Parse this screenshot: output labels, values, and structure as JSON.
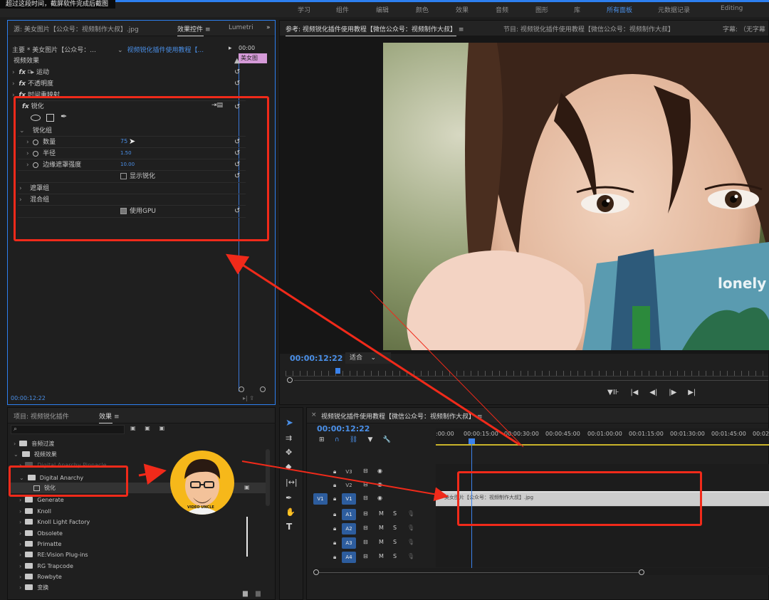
{
  "hint": "超过这段时间，截屏软件完成后截图",
  "workspaces": [
    "学习",
    "组件",
    "编辑",
    "颜色",
    "效果",
    "音频",
    "图形",
    "库",
    "所有面板",
    "元数据记录",
    "Editing"
  ],
  "source_panel": {
    "tab_source": "源: 美女图片【公众号：视频制作大叔】.jpg",
    "tab_effect_controls": "效果控件",
    "tab_lumetri": "Lumetri",
    "master_label": "主要 * 美女图片【公众号：...",
    "sequence_label": "视频锐化插件使用教程【...",
    "time_top": "00:00",
    "clip_label": "美女图",
    "video_effects_label": "视频效果",
    "motion": "运动",
    "opacity": "不透明度",
    "time_remap": "时间重映射",
    "sharpen": "锐化",
    "sharpen_group": "锐化组",
    "amount_label": "数量",
    "amount_value": "75",
    "radius_label": "半径",
    "radius_value": "1.50",
    "edge_label": "边缘遮罩强度",
    "edge_value": "10.00",
    "show_sharpen": "显示锐化",
    "mask_group": "遮罩组",
    "blend_group": "混合组",
    "use_gpu": "使用GPU",
    "timecode": "00:00:12:22"
  },
  "program_panel": {
    "tab_reference": "参考: 视频锐化插件使用教程【微信公众号：视频制作大叔】",
    "tab_program": "节目: 视频锐化插件使用教程【微信公众号：视频制作大叔】",
    "tab_caption": "字幕: （无字幕",
    "timecode": "00:00:12:22",
    "fit": "适合"
  },
  "project_panel": {
    "tab_project": "项目: 视频锐化插件",
    "tab_effects": "效果",
    "items": [
      {
        "label": "音频过渡",
        "indent": 0
      },
      {
        "label": "视频效果",
        "indent": 0
      },
      {
        "label": "Digital Anarchy Pinnacle...",
        "indent": 1
      },
      {
        "label": "Digital Anarchy",
        "indent": 1
      },
      {
        "label": "锐化",
        "indent": 2
      },
      {
        "label": "Generate",
        "indent": 1
      },
      {
        "label": "Knoll",
        "indent": 1
      },
      {
        "label": "Knoll Light Factory",
        "indent": 1
      },
      {
        "label": "Obsolete",
        "indent": 1
      },
      {
        "label": "Primatte",
        "indent": 1
      },
      {
        "label": "RE:Vision Plug-ins",
        "indent": 1
      },
      {
        "label": "RG Trapcode",
        "indent": 1
      },
      {
        "label": "Rowbyte",
        "indent": 1
      },
      {
        "label": "变换",
        "indent": 1
      }
    ],
    "badge_text": "VIDEO UNCLE"
  },
  "timeline": {
    "title": "视频锐化插件使用教程【微信公众号：视频制作大叔】",
    "timecode": "00:00:12:22",
    "ruler": [
      ":00:00",
      "00:00:15:00",
      "00:00:30:00",
      "00:00:45:00",
      "00:01:00:00",
      "00:01:15:00",
      "00:01:30:00",
      "00:01:45:00",
      "00:02"
    ],
    "tracks": [
      "V3",
      "V2",
      "V1",
      "A1",
      "A2",
      "A3",
      "A4"
    ],
    "track_m": "M",
    "track_s": "S",
    "v1_source": "V1",
    "clip": "美女图片【公众号：视频制作大叔】.jpg"
  }
}
